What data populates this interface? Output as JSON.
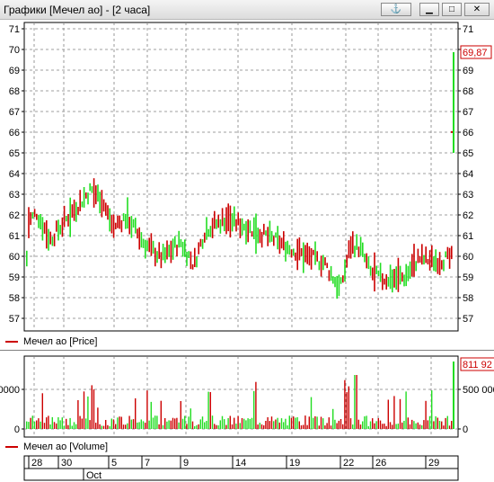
{
  "window": {
    "title": "Графики [Мечел ао] - [2 часа]",
    "pin_glyph": "⚓",
    "min_glyph": "▁",
    "max_glyph": "□",
    "close_glyph": "✕"
  },
  "price_panel": {
    "legend": "Мечел ао [Price]",
    "y_ticks": [
      "71",
      "70",
      "69",
      "68",
      "67",
      "66",
      "65",
      "64",
      "63",
      "62",
      "61",
      "60",
      "59",
      "58",
      "57"
    ],
    "last_value_label": "69,87",
    "colors": {
      "up": "#22dd22",
      "down": "#cc0000",
      "grid": "#808080",
      "last_label": "#cc0000"
    }
  },
  "volume_panel": {
    "legend": "Мечел ао [Volume]",
    "left_ticks": [
      "0000",
      "0"
    ],
    "right_ticks": [
      "500 000",
      "0"
    ],
    "last_value_label": "811 92"
  },
  "date_axis": {
    "day_labels": [
      "28",
      "30",
      "5",
      "7",
      "9",
      "14",
      "19",
      "22",
      "26",
      "29"
    ],
    "month_label": "Oct"
  }
}
